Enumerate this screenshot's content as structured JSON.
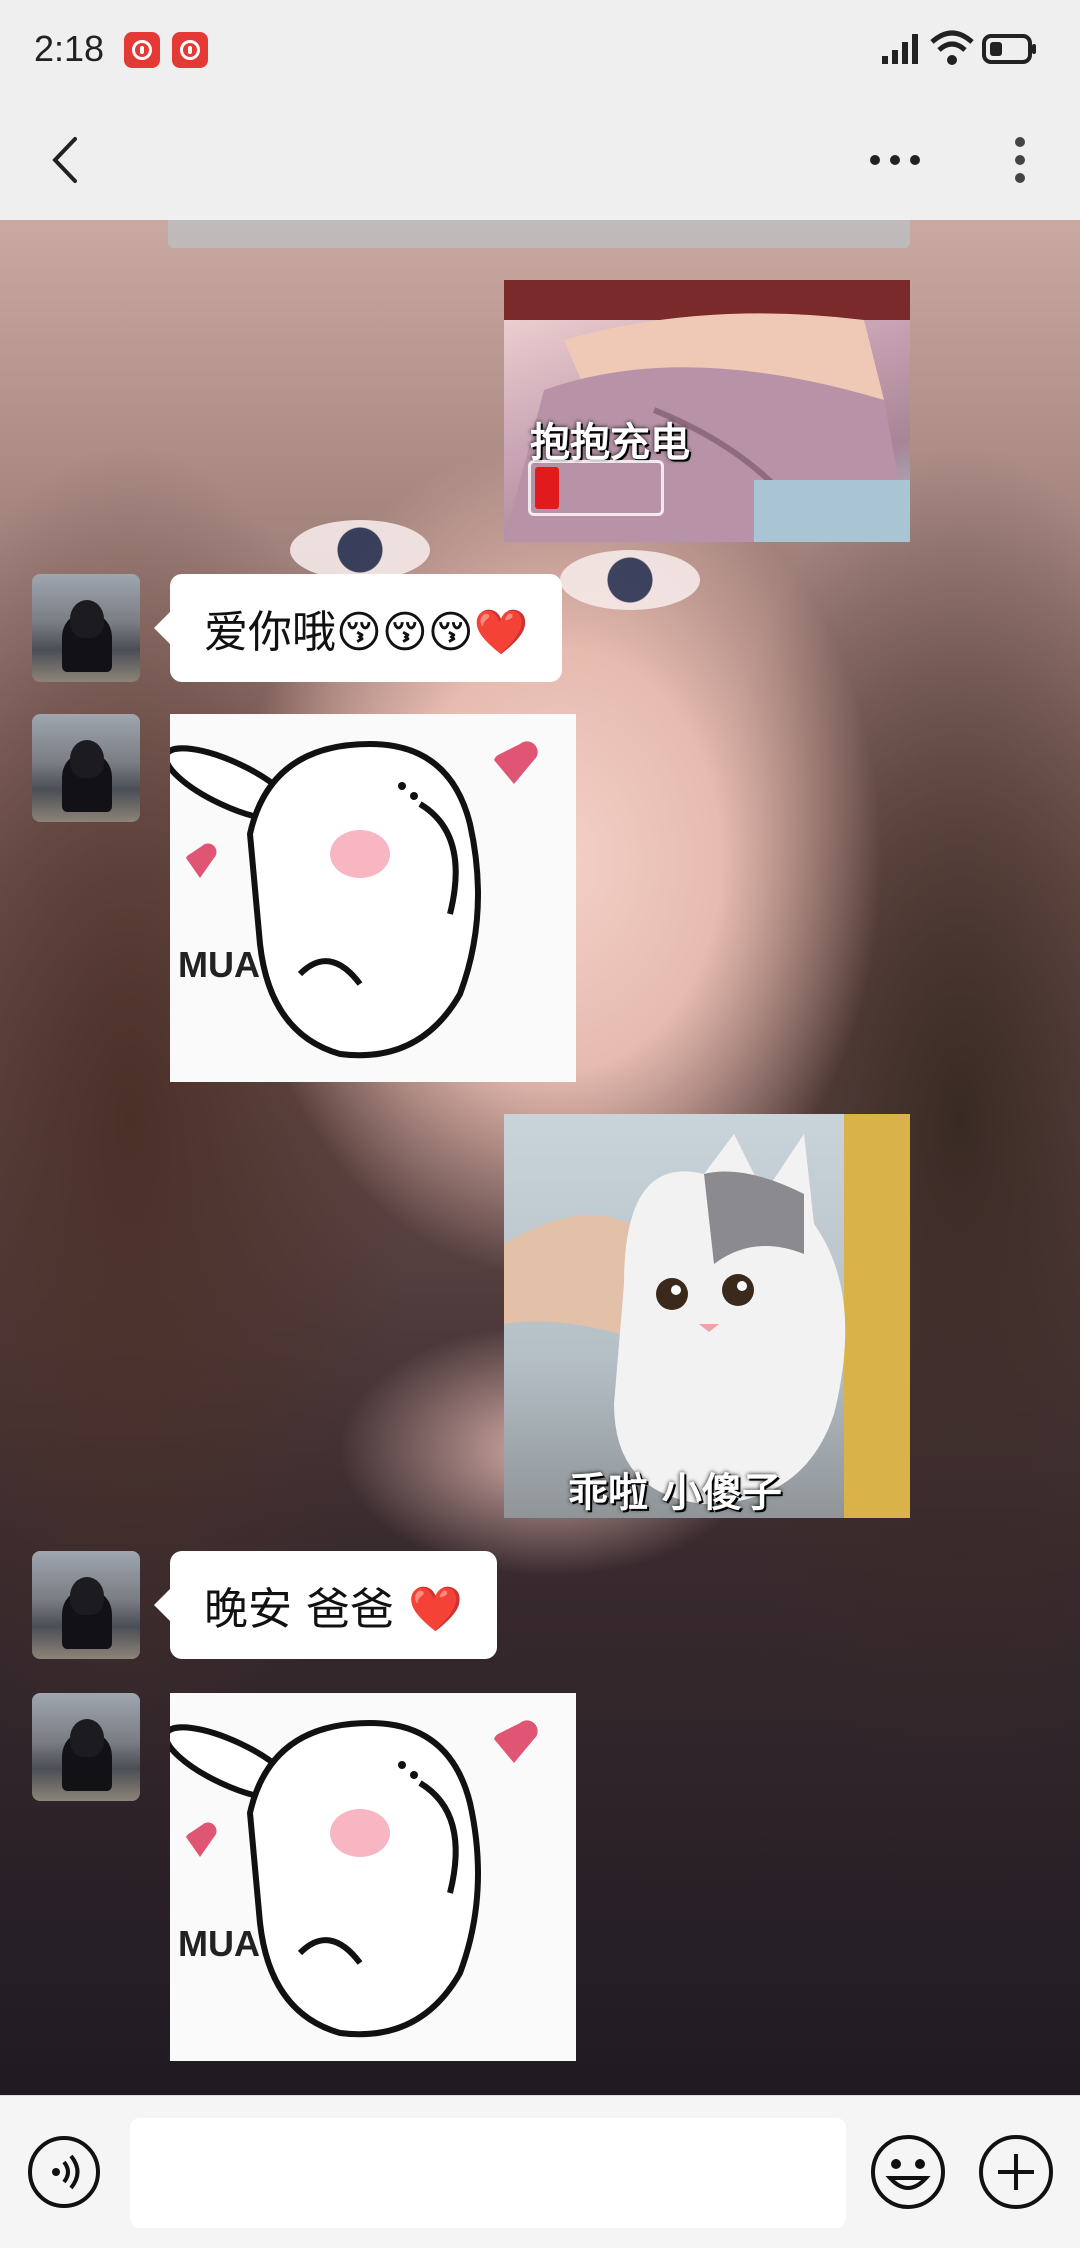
{
  "status_bar": {
    "time": "2:18"
  },
  "header": {
    "back": "back",
    "more_dots": "more",
    "more_vertical": "menu"
  },
  "messages": {
    "sticker_charge": {
      "caption": "抱抱充电"
    },
    "msg1": {
      "text": "爱你哦😚😚😚❤️"
    },
    "sticker_mua1": {
      "label": "MUA"
    },
    "sticker_cat": {
      "caption": "乖啦 小傻子"
    },
    "msg2": {
      "text": "晚安 爸爸 ❤️"
    },
    "sticker_mua2": {
      "label": "MUA"
    }
  },
  "input": {
    "placeholder": ""
  },
  "colors": {
    "status_bg": "#efefef",
    "bubble_bg": "#ffffff",
    "accent_red": "#e53935"
  }
}
